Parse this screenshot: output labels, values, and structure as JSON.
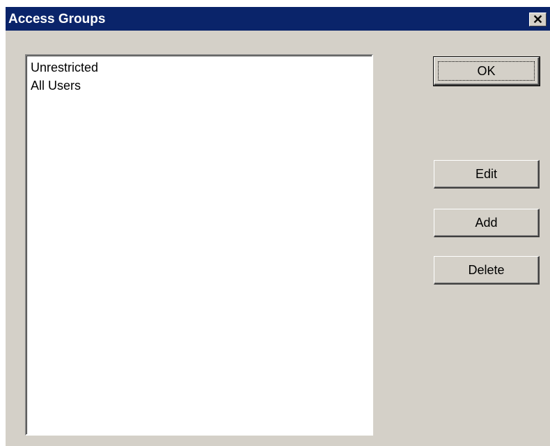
{
  "window": {
    "title": "Access Groups",
    "close_glyph": "✕"
  },
  "list": {
    "items": [
      "Unrestricted",
      "All Users"
    ]
  },
  "buttons": {
    "ok_label": "OK",
    "edit_label": "Edit",
    "add_label": "Add",
    "delete_label": "Delete"
  }
}
